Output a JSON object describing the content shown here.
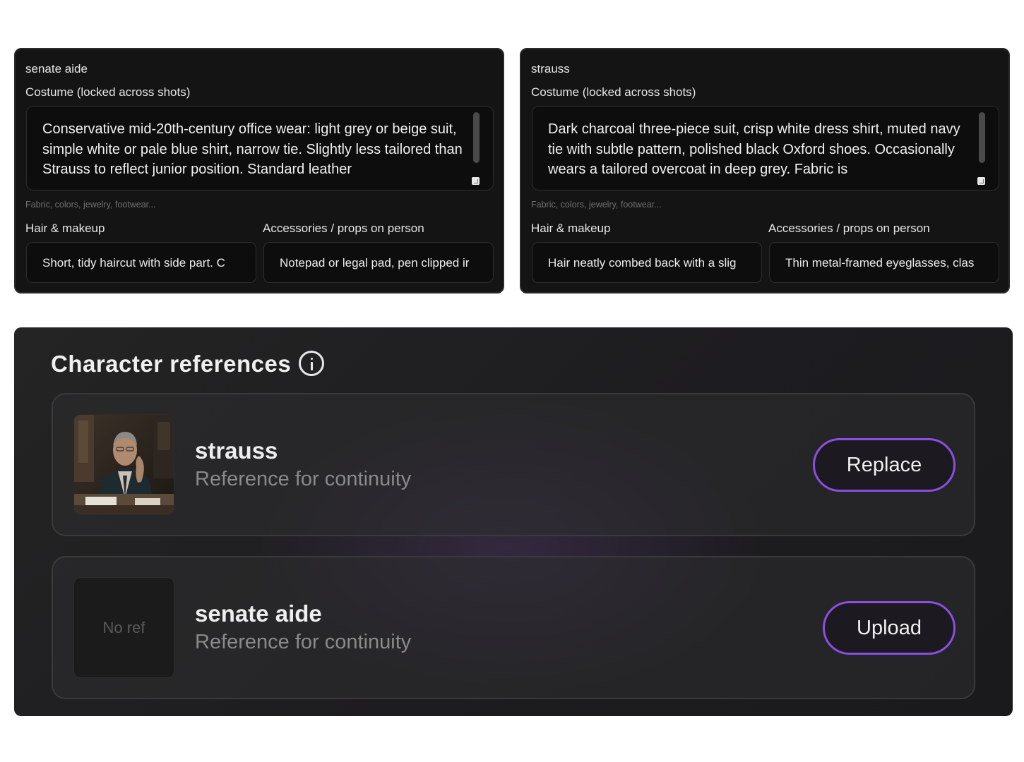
{
  "cards": [
    {
      "name": "senate aide",
      "costume_label": "Costume (locked across shots)",
      "costume_text": "Conservative mid-20th-century office wear: light grey or beige suit, simple white or pale blue shirt, narrow tie. Slightly less tailored than Strauss to reflect junior position. Standard leather",
      "costume_placeholder": "Fabric, colors, jewelry, footwear...",
      "hair_label": "Hair & makeup",
      "hair_value": "Short, tidy haircut with side part. C",
      "accessories_label": "Accessories / props on person",
      "accessories_value": "Notepad or legal pad, pen clipped ir"
    },
    {
      "name": "strauss",
      "costume_label": "Costume (locked across shots)",
      "costume_text": "Dark charcoal three-piece suit, crisp white dress shirt, muted navy tie with subtle pattern, polished black Oxford shoes. Occasionally wears a tailored overcoat in deep grey. Fabric is",
      "costume_placeholder": "Fabric, colors, jewelry, footwear...",
      "hair_label": "Hair & makeup",
      "hair_value": "Hair neatly combed back with a slig",
      "accessories_label": "Accessories / props on person",
      "accessories_value": "Thin metal-framed eyeglasses, clas"
    }
  ],
  "references": {
    "title": "Character references",
    "info_icon": "info-icon",
    "items": [
      {
        "name": "strauss",
        "subtitle": "Reference for continuity",
        "has_image": true,
        "button_label": "Replace"
      },
      {
        "name": "senate aide",
        "subtitle": "Reference for continuity",
        "has_image": false,
        "placeholder": "No ref",
        "button_label": "Upload"
      }
    ]
  },
  "colors": {
    "accent": "#8b4ee0",
    "card_bg": "#141414",
    "panel_bg": "#1f1f21",
    "muted_text": "#8a8a8a"
  }
}
